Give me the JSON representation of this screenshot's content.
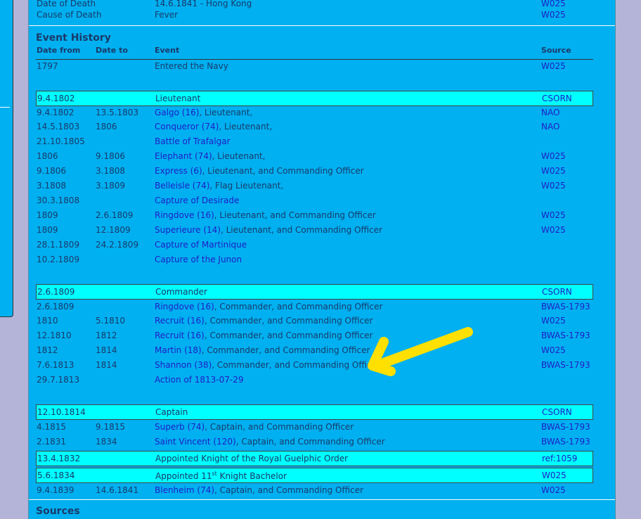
{
  "top_rows": [
    {
      "label": "Date of Death",
      "value": "14.6.1841 - Hong Kong",
      "source": "W025"
    },
    {
      "label": "Cause of Death",
      "value": "Fever",
      "source": "W025"
    }
  ],
  "event_history": {
    "title": "Event History",
    "headers": {
      "date_from": "Date from",
      "date_to": "Date to",
      "event": "Event",
      "source": "Source"
    },
    "rows": [
      {
        "from": "1797",
        "to": "",
        "event": "Entered the Navy",
        "ship": "",
        "role": "",
        "source": "W025",
        "hl": false
      },
      {
        "from": "9.4.1802",
        "to": "",
        "event": "Lieutenant",
        "ship": "",
        "role": "",
        "source": "CSORN",
        "hl": true
      },
      {
        "from": "9.4.1802",
        "to": "13.5.1803",
        "event": "",
        "ship": "Galgo (16)",
        "role": ", Lieutenant,",
        "source": "NAO",
        "hl": false
      },
      {
        "from": "14.5.1803",
        "to": "1806",
        "event": "",
        "ship": "Conqueror (74)",
        "role": ", Lieutenant,",
        "source": "NAO",
        "hl": false
      },
      {
        "from": "21.10.1805",
        "to": "",
        "event": "",
        "ship": "Battle of Trafalgar",
        "role": "",
        "source": "",
        "hl": false
      },
      {
        "from": "1806",
        "to": "9.1806",
        "event": "",
        "ship": "Elephant (74)",
        "role": ", Lieutenant,",
        "source": "W025",
        "hl": false
      },
      {
        "from": "9.1806",
        "to": "3.1808",
        "event": "",
        "ship": "Express (6)",
        "role": ", Lieutenant, and Commanding Officer",
        "source": "W025",
        "hl": false
      },
      {
        "from": "3.1808",
        "to": "3.1809",
        "event": "",
        "ship": "Belleisle (74)",
        "role": ", Flag Lieutenant,",
        "source": "W025",
        "hl": false
      },
      {
        "from": "30.3.1808",
        "to": "",
        "event": "",
        "ship": "Capture of Desirade",
        "role": "",
        "source": "",
        "hl": false
      },
      {
        "from": "1809",
        "to": "2.6.1809",
        "event": "",
        "ship": "Ringdove (16)",
        "role": ", Lieutenant, and Commanding Officer",
        "source": "W025",
        "hl": false
      },
      {
        "from": "1809",
        "to": "12.1809",
        "event": "",
        "ship": "Superieure (14)",
        "role": ", Lieutenant, and Commanding Officer",
        "source": "W025",
        "hl": false
      },
      {
        "from": "28.1.1809",
        "to": "24.2.1809",
        "event": "",
        "ship": "Capture of Martinique",
        "role": "",
        "source": "",
        "hl": false
      },
      {
        "from": "10.2.1809",
        "to": "",
        "event": "",
        "ship": "Capture of the Junon",
        "role": "",
        "source": "",
        "hl": false
      },
      {
        "from": "2.6.1809",
        "to": "",
        "event": "Commander",
        "ship": "",
        "role": "",
        "source": "CSORN",
        "hl": true
      },
      {
        "from": "2.6.1809",
        "to": "",
        "event": "",
        "ship": "Ringdove (16)",
        "role": ", Commander, and Commanding Officer",
        "source": "BWAS-1793",
        "hl": false
      },
      {
        "from": "1810",
        "to": "5.1810",
        "event": "",
        "ship": "Recruit (16)",
        "role": ", Commander, and Commanding Officer",
        "source": "W025",
        "hl": false
      },
      {
        "from": "12.1810",
        "to": "1812",
        "event": "",
        "ship": "Recruit (16)",
        "role": ", Commander, and Commanding Officer",
        "source": "BWAS-1793",
        "hl": false
      },
      {
        "from": "1812",
        "to": "1814",
        "event": "",
        "ship": "Martin (18)",
        "role": ", Commander, and Commanding Officer",
        "source": "W025",
        "hl": false
      },
      {
        "from": "7.6.1813",
        "to": "1814",
        "event": "",
        "ship": "Shannon (38)",
        "role": ", Commander, and Commanding Officer",
        "source": "BWAS-1793",
        "hl": false
      },
      {
        "from": "29.7.1813",
        "to": "",
        "event": "",
        "ship": "Action of 1813-07-29",
        "role": "",
        "source": "",
        "hl": false
      },
      {
        "from": "12.10.1814",
        "to": "",
        "event": "Captain",
        "ship": "",
        "role": "",
        "source": "CSORN",
        "hl": true
      },
      {
        "from": "4.1815",
        "to": "9.1815",
        "event": "",
        "ship": "Superb (74)",
        "role": ", Captain, and Commanding Officer",
        "source": "BWAS-1793",
        "hl": false
      },
      {
        "from": "2.1831",
        "to": "1834",
        "event": "",
        "ship": "Saint Vincent (120)",
        "role": ", Captain, and Commanding Officer",
        "source": "BWAS-1793",
        "hl": false
      },
      {
        "from": "13.4.1832",
        "to": "",
        "event": "Appointed Knight of the Royal Guelphic Order",
        "ship": "",
        "role": "",
        "source": "ref:1059",
        "hl": true
      },
      {
        "from": "5.6.1834",
        "to": "",
        "event": "Appointed 11",
        "sup": "st",
        "event_tail": " Knight Bachelor",
        "ship": "",
        "role": "",
        "source": "W025",
        "hl": true
      },
      {
        "from": "9.4.1839",
        "to": "14.6.1841",
        "event": "",
        "ship": "Blenheim (74)",
        "role": ", Captain, and Commanding Officer",
        "source": "W025",
        "hl": false
      }
    ]
  },
  "sources": {
    "title": "Sources"
  },
  "colors": {
    "page_bg": "#b4b4d8",
    "panel": "#00b0f0",
    "highlight": "#00ffff",
    "link": "#2020c8",
    "arrow": "#ffe000"
  }
}
